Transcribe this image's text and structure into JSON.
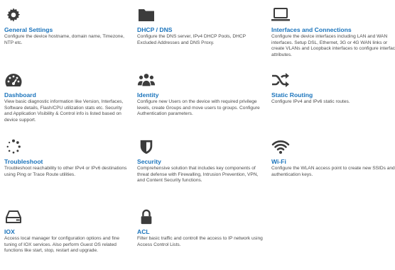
{
  "theme": {
    "title_color": "#1b74bc",
    "icon_color": "#3c3c3c",
    "text_color": "#4a4a4a"
  },
  "tiles": [
    {
      "icon": "gear-icon",
      "title": "General Settings",
      "desc": "Configure the device hostname, domain name, Timezone, NTP etc."
    },
    {
      "icon": "folder-icon",
      "title": "DHCP / DNS",
      "desc": "Configure the DNS server, IPv4 DHCP Pools, DHCP Excluded Addresses and DNS Proxy."
    },
    {
      "icon": "laptop-icon",
      "title": "Interfaces and Connections",
      "desc": "Configure the device interfaces including LAN and WAN interfaces. Setup DSL, Ethernet, 3G or 4G WAN links or create VLANs and Loopback interfaces to configure interface attributes."
    },
    {
      "icon": "gauge-icon",
      "title": "Dashboard",
      "desc": "View basic diagnostic information like Version, Interfaces, Software details, Flash/CPU utilization stats etc. Security and Application Visibility & Control info is listed based on device support."
    },
    {
      "icon": "users-icon",
      "title": "Identity",
      "desc": "Configure new Users on the device with required privilege levels, create Groups and move users to groups. Configure Authentication parameters."
    },
    {
      "icon": "shuffle-icon",
      "title": "Static Routing",
      "desc": "Configure IPv4 and IPv6 static routes."
    },
    {
      "icon": "spinner-icon",
      "title": "Troubleshoot",
      "desc": "Troubleshoot reachability to other IPv4 or IPv6 destinations using Ping or Trace Route utilities."
    },
    {
      "icon": "shield-icon",
      "title": "Security",
      "desc": "Comprehensive solution that includes key components of threat defense with Firewalling, Intrusion Prevention, VPN, and Content Security functions."
    },
    {
      "icon": "wifi-icon",
      "title": "Wi-Fi",
      "desc": "Configure the WLAN access point to create new SSIDs and authentication keys."
    },
    {
      "icon": "hard-drive-icon",
      "title": "IOX",
      "desc": "Access local manager for configuration options and fine tuning of IOX services. Also perform Guest OS related functions like start, stop, restart and upgrade."
    },
    {
      "icon": "lock-icon",
      "title": "ACL",
      "desc": "Filter basic traffic and controll the access to IP network using Access Control Lists."
    }
  ]
}
